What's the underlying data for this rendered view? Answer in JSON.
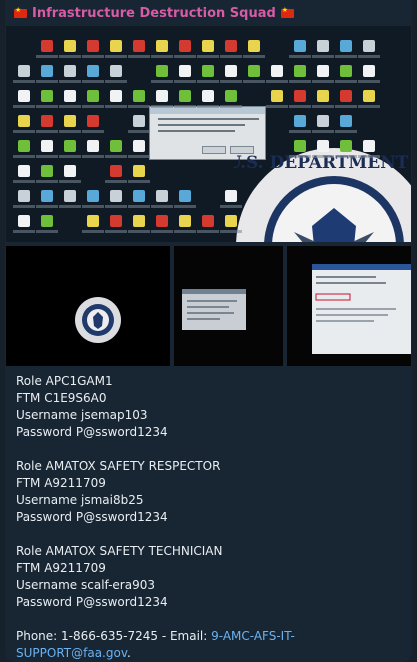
{
  "header": {
    "title": "Infrastructure Destruction Squad",
    "title_color": "#d75ba6",
    "flag_icon": "china-flag-icon"
  },
  "media": {
    "main_image": "desktop-screenshot-with-dhs-seal",
    "thumbnails": [
      "dhs-seal-thumbnail",
      "document-window-thumbnail",
      "email-window-thumbnail"
    ],
    "seal_text": "U.S. DEPARTMENT OF"
  },
  "accounts": [
    {
      "role": "Role APC1GAM1",
      "ftm": "FTM C1E9S6A0",
      "username": "Username jsemap103",
      "password": "Password P@ssword1234"
    },
    {
      "role": "Role AMATOX SAFETY RESPECTOR",
      "ftm": "FTM A9211709",
      "username": "Username jsmai8b25",
      "password": "Password P@ssword1234"
    },
    {
      "role": "Role AMATOX SAFETY TECHNICIAN",
      "ftm": "FTM A9211709",
      "username": "Username scalf-era903",
      "password": "Password P@ssword1234"
    }
  ],
  "contact": {
    "prefix": "Phone: 1-866-635-7245 - Email: ",
    "email": "9-AMC-AFS-IT-SUPPORT@faa.gov",
    "suffix": "."
  },
  "colors": {
    "background": "#17212b",
    "bubble": "#182533",
    "link": "#6ab3f3"
  }
}
